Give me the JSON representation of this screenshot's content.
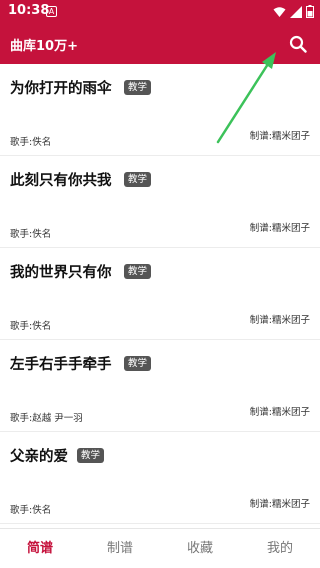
{
  "status_bar": {
    "time": "10:38",
    "a_icon": "A",
    "icons": [
      "wifi-icon",
      "signal-icon",
      "battery-icon"
    ]
  },
  "app_bar": {
    "title": "曲库10万+",
    "search_icon": "search-icon"
  },
  "songs": [
    {
      "title": "为你打开的雨伞",
      "badge": "教学",
      "singer": "歌手:佚名",
      "maker": "制谱:糯米团子"
    },
    {
      "title": "此刻只有你共我",
      "badge": "教学",
      "singer": "歌手:佚名",
      "maker": "制谱:糯米团子"
    },
    {
      "title": "我的世界只有你",
      "badge": "教学",
      "singer": "歌手:佚名",
      "maker": "制谱:糯米团子"
    },
    {
      "title": "左手右手手牵手",
      "badge": "教学",
      "singer": "歌手:赵越 尹一羽",
      "maker": "制谱:糯米团子"
    },
    {
      "title": "父亲的爱",
      "badge": "教学",
      "singer": "歌手:佚名",
      "maker": "制谱:糯米团子"
    }
  ],
  "bottom_nav": [
    {
      "label": "简谱",
      "active": true
    },
    {
      "label": "制谱",
      "active": false
    },
    {
      "label": "收藏",
      "active": false
    },
    {
      "label": "我的",
      "active": false
    }
  ],
  "colors": {
    "brand": "#c5123c",
    "badge": "#555555",
    "annotation_arrow": "#3cc25a"
  }
}
